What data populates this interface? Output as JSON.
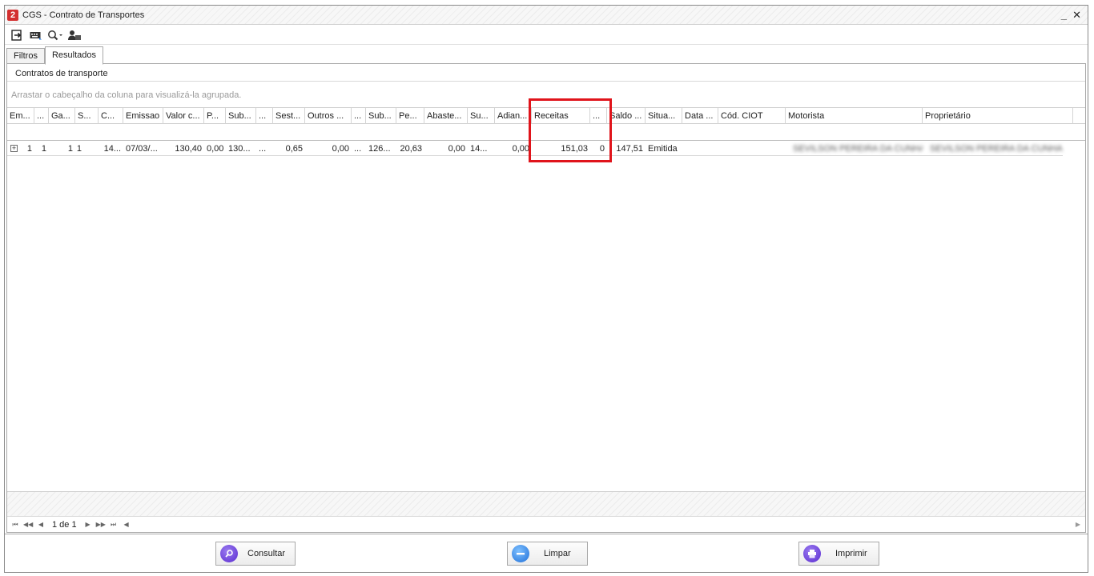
{
  "window": {
    "title": "CGS - Contrato de Transportes",
    "minimize_glyph": "_",
    "close_glyph": "✕",
    "logo_glyph": "2"
  },
  "toolbar": {
    "icons": [
      "exit-icon",
      "keyboard-icon",
      "search-dropdown-icon",
      "user-icon"
    ]
  },
  "tabs": [
    {
      "label": "Filtros",
      "active": false
    },
    {
      "label": "Resultados",
      "active": true
    }
  ],
  "panel": {
    "caption": "Contratos de transporte",
    "group_hint": "Arrastar o cabeçalho da coluna para visualizá-la agrupada."
  },
  "grid": {
    "columns": [
      "Em...",
      "...",
      "Ga...",
      "S...",
      "C...",
      "Emissao",
      "Valor c...",
      "P...",
      "Sub...",
      "...",
      "Sest...",
      "Outros ...",
      "...",
      "Sub...",
      "Pe...",
      "Abaste...",
      "Su...",
      "Adian...",
      "Receitas",
      "...",
      "Saldo ...",
      "Situa...",
      "Data ...",
      "Cód. CIOT",
      "Motorista",
      "Proprietário"
    ],
    "row": {
      "expand_glyph": "+",
      "cells": [
        "1",
        "1",
        "1",
        "1",
        "14...",
        "07/03/...",
        "130,40",
        "0,00",
        "130...",
        "...",
        "0,65",
        "0,00",
        "...",
        "126...",
        "20,63",
        "0,00",
        "14...",
        "0,00",
        "151,03",
        "0",
        "147,51",
        "Emitida",
        "",
        "",
        "SEVILSON PEREIRA DA CUNHA",
        "SEVILSON PEREIRA DA CUNHA"
      ]
    }
  },
  "pager": {
    "text": "1 de 1"
  },
  "actions": {
    "consultar": "Consultar",
    "limpar": "Limpar",
    "imprimir": "Imprimir"
  },
  "colors": {
    "highlight": "#e0141b",
    "logo": "#d32f2f"
  }
}
